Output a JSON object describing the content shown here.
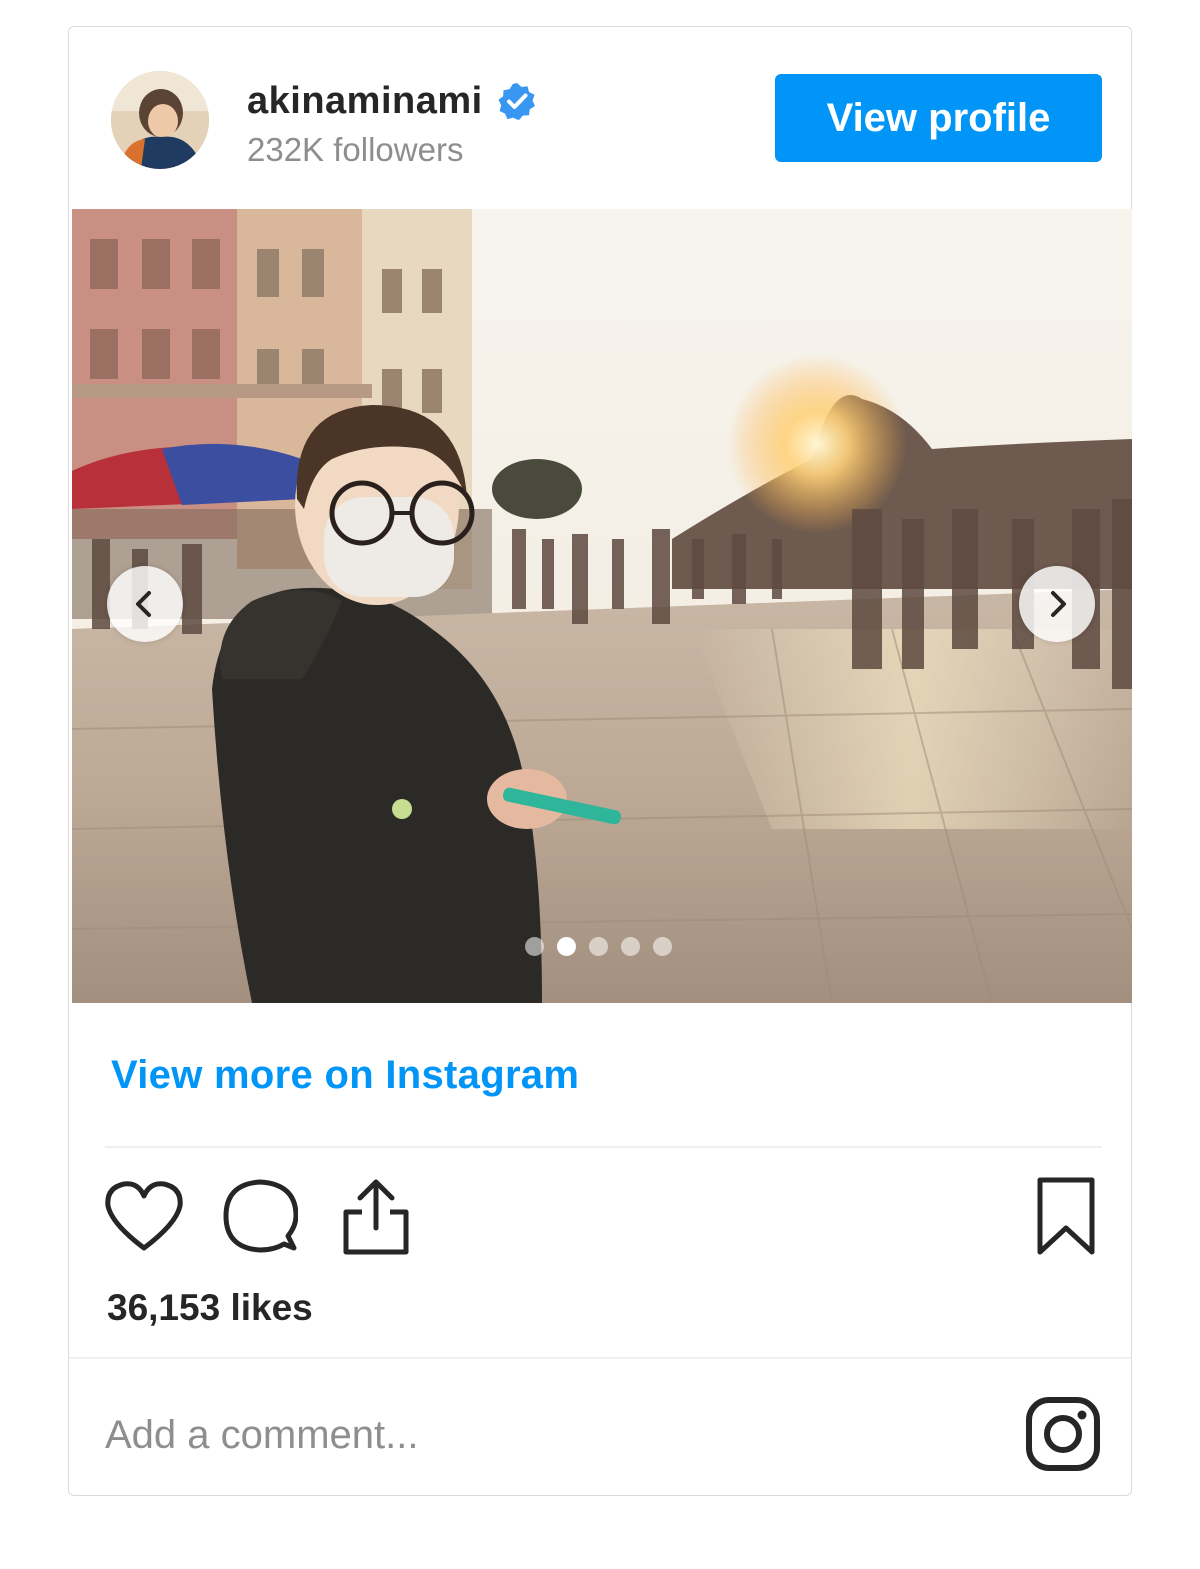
{
  "post": {
    "username": "akinaminami",
    "followers": "232K followers",
    "view_profile_label": "View profile",
    "view_more_label": "View more on Instagram",
    "likes": "36,153 likes",
    "comment_placeholder": "Add a comment...",
    "carousel": {
      "total": 5,
      "active_index": 1
    }
  },
  "icons": {
    "verified": "verified-badge-icon",
    "prev": "chevron-left-icon",
    "next": "chevron-right-icon",
    "like": "heart-icon",
    "comment": "comment-icon",
    "share": "share-icon",
    "save": "bookmark-icon",
    "brand": "instagram-icon"
  },
  "colors": {
    "accent": "#0095f6",
    "text": "#262626",
    "muted": "#8e8e8e",
    "border": "#dbdbdb"
  }
}
